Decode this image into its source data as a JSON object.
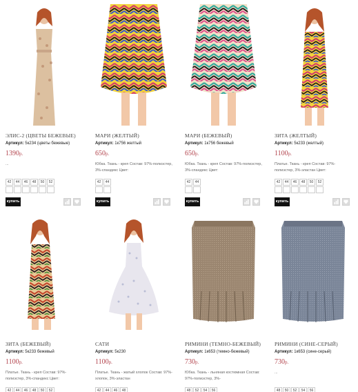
{
  "products": [
    {
      "name": "ЭЛИС-2 (ЦВЕТЫ БЕЖЕВЫЕ)",
      "sku_label": "Артикул:",
      "sku": "5к234 (цветы бежевые)",
      "price": "1390",
      "currency": "р.",
      "desc": "...",
      "sizes": [
        "42",
        "44",
        "46",
        "48",
        "50",
        "52"
      ],
      "buy_label": "купить"
    },
    {
      "name": "МАРИ (ЖЕЛТЫЙ)",
      "sku_label": "Артикул:",
      "sku": "1к756 желтый",
      "price": "650",
      "currency": "р.",
      "desc": "Юбка. Ткань - креп Состав: 97%-полиэстер, 3%-спандекс Цвет:",
      "sizes": [
        "42",
        "44"
      ],
      "buy_label": "купить"
    },
    {
      "name": "МАРИ (БЕЖЕВЫЙ)",
      "sku_label": "Артикул:",
      "sku": "1к756 бежевый",
      "price": "650",
      "currency": "р.",
      "desc": "Юбка. Ткань - креп Состав: 97%-полиэстер, 3%-спандекс Цвет:",
      "sizes": [
        "42",
        "44"
      ],
      "buy_label": "купить"
    },
    {
      "name": "ЗИТА (ЖЕЛТЫЙ)",
      "sku_label": "Артикул:",
      "sku": "5к233 (желтый)",
      "price": "1100",
      "currency": "р.",
      "desc": "Платье. Ткань - креп Состав: 97%-полиэстер, 3%-эластан Цвет:",
      "sizes": [
        "42",
        "44",
        "46",
        "48",
        "50",
        "52"
      ],
      "buy_label": "купить"
    },
    {
      "name": "ЗИТА (БЕЖЕВЫЙ)",
      "sku_label": "Артикул:",
      "sku": "5к233 бежевый",
      "price": "1100",
      "currency": "р.",
      "desc": "Платье. Ткань - креп Состав: 97%-полиэстер, 3%-спандекс Цвет:",
      "sizes": [
        "42",
        "44",
        "46",
        "48",
        "50",
        "52"
      ]
    },
    {
      "name": "САТИ",
      "sku_label": "Артикул:",
      "sku": "5к230",
      "price": "1100",
      "currency": "р.",
      "desc": "Платье. Ткань - жатый хлопок Состав: 97%-хлопок, 3%-эластан",
      "sizes": [
        "42",
        "44",
        "46",
        "48"
      ]
    },
    {
      "name": "РИМИНИ (ТЕМНО-БЕЖЕВЫЙ)",
      "sku_label": "Артикул:",
      "sku": "1к653 (темно-бежевый)",
      "price": "730",
      "currency": "р.",
      "desc": "Юбка. Ткань - льняная костюмная Состав: 97%-полиэстер, 3%-",
      "sizes": [
        "48",
        "52",
        "54",
        "56"
      ]
    },
    {
      "name": "РИМИНИ (СИНЕ-СЕРЫЙ)",
      "sku_label": "Артикул:",
      "sku": "1к653 (сине-серый)",
      "price": "730",
      "currency": "р.",
      "desc": "...",
      "sizes": [
        "48",
        "50",
        "52",
        "54",
        "56"
      ]
    }
  ],
  "colors": {
    "price": "#b2434c",
    "buy_bg": "#111111"
  },
  "icons": {
    "compare": "bar-chart-icon",
    "favorite": "heart-icon"
  }
}
